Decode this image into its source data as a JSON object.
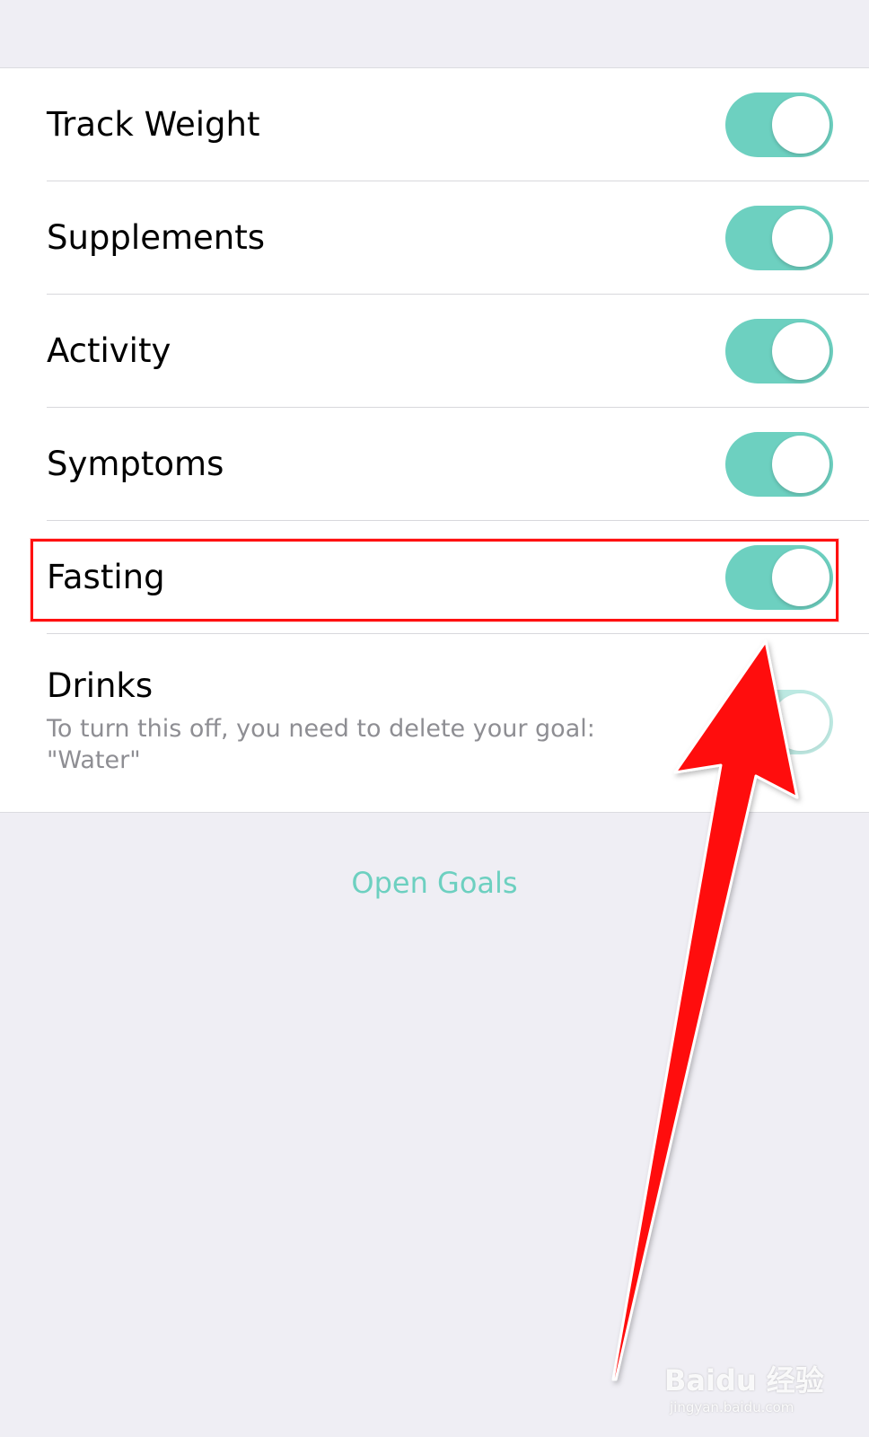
{
  "colors": {
    "accent": "#6dd0c0",
    "background": "#efeef4",
    "annotation_red": "#ff1010",
    "secondary_text": "#8e8e93"
  },
  "settings": {
    "rows": [
      {
        "label": "Track Weight",
        "toggle_on": true
      },
      {
        "label": "Supplements",
        "toggle_on": true
      },
      {
        "label": "Activity",
        "toggle_on": true
      },
      {
        "label": "Symptoms",
        "toggle_on": true
      },
      {
        "label": "Fasting",
        "toggle_on": true
      },
      {
        "label": "Drinks",
        "toggle_on": true
      }
    ],
    "drinks_note": "To turn this off, you need to delete your goal: \"Water\""
  },
  "open_goals_label": "Open Goals",
  "watermark": {
    "brand": "Baidu 经验",
    "url": "jingyan.baidu.com"
  },
  "icons": {
    "toggle": "toggle-switch",
    "annotation_arrow": "red-arrow-icon",
    "watermark_logo": "baidu-paw-icon"
  }
}
